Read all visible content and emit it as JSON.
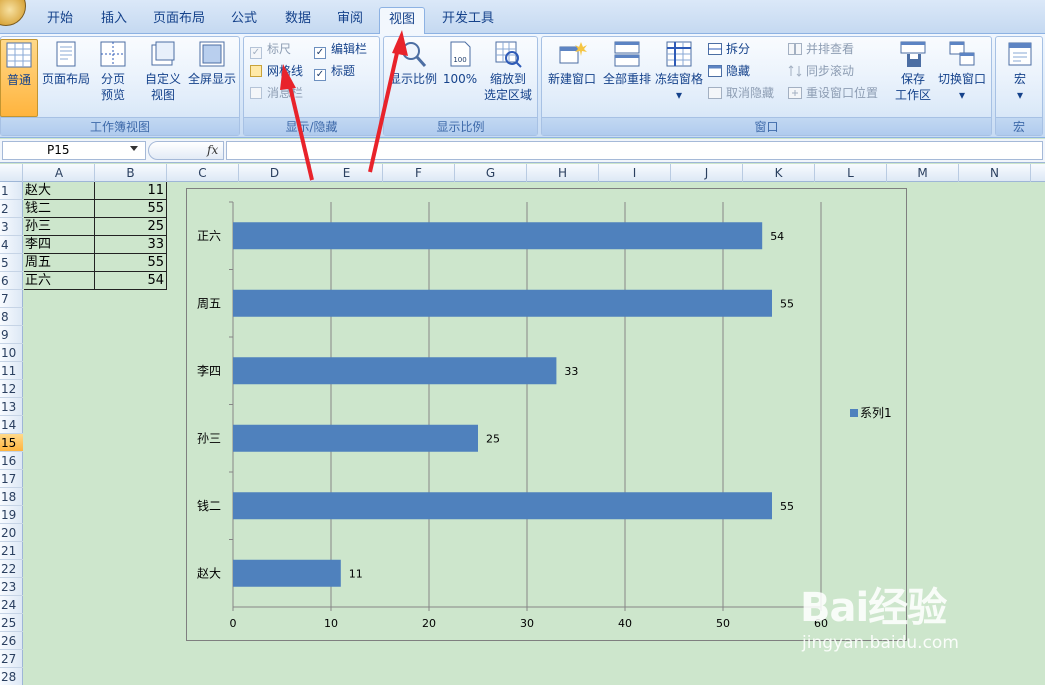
{
  "tabs": [
    {
      "label": "开始",
      "active": false
    },
    {
      "label": "插入",
      "active": false
    },
    {
      "label": "页面布局",
      "active": false
    },
    {
      "label": "公式",
      "active": false
    },
    {
      "label": "数据",
      "active": false
    },
    {
      "label": "审阅",
      "active": false
    },
    {
      "label": "视图",
      "active": true
    },
    {
      "label": "开发工具",
      "active": false
    }
  ],
  "ribbon": {
    "workbook_views": {
      "label": "工作簿视图",
      "normal": "普通",
      "page_layout": "页面布局",
      "page_break_line1": "分页",
      "page_break_line2": "预览",
      "custom_line1": "自定义",
      "custom_line2": "视图",
      "full_screen": "全屏显示"
    },
    "show_hide": {
      "label": "显示/隐藏",
      "ruler": "标尺",
      "gridlines": "网格线",
      "message_bar": "消息栏",
      "formula_bar": "编辑栏",
      "headings": "标题",
      "ruler_checked": true,
      "gridlines_checked": false,
      "message_bar_checked": false,
      "formula_bar_checked": true,
      "headings_checked": true
    },
    "zoom": {
      "label": "显示比例",
      "zoom": "显示比例",
      "hundred": "100%",
      "hundred_icon_text": "100",
      "zoom_sel_line1": "缩放到",
      "zoom_sel_line2": "选定区域"
    },
    "window": {
      "label": "窗口",
      "new_window": "新建窗口",
      "arrange_all": "全部重排",
      "freeze_panes": "冻结窗格",
      "split": "拆分",
      "hide": "隐藏",
      "unhide": "取消隐藏",
      "side_by_side": "并排查看",
      "sync_scroll": "同步滚动",
      "reset_position": "重设窗口位置",
      "save_workspace_line1": "保存",
      "save_workspace_line2": "工作区",
      "switch_windows": "切换窗口"
    },
    "macros": {
      "label": "宏",
      "macros": "宏"
    }
  },
  "formula_bar": {
    "name_box": "P15",
    "fx": "fx",
    "formula": ""
  },
  "columns": [
    "A",
    "B",
    "C",
    "D",
    "E",
    "F",
    "G",
    "H",
    "I",
    "J",
    "K",
    "L",
    "M",
    "N"
  ],
  "rows": [
    "1",
    "2",
    "3",
    "4",
    "5",
    "6",
    "7",
    "8",
    "9",
    "10",
    "11",
    "12",
    "13",
    "14",
    "15",
    "16",
    "17",
    "18",
    "19",
    "20",
    "21",
    "22",
    "23",
    "24",
    "25",
    "26",
    "27",
    "28"
  ],
  "selected_row": "15",
  "table": [
    {
      "name": "赵大",
      "value": "11"
    },
    {
      "name": "钱二",
      "value": "55"
    },
    {
      "name": "孙三",
      "value": "25"
    },
    {
      "name": "李四",
      "value": "33"
    },
    {
      "name": "周五",
      "value": "55"
    },
    {
      "name": "正六",
      "value": "54"
    }
  ],
  "chart_data": {
    "type": "bar",
    "orientation": "horizontal",
    "categories": [
      "赵大",
      "钱二",
      "孙三",
      "李四",
      "周五",
      "正六"
    ],
    "series": [
      {
        "name": "系列1",
        "values": [
          11,
          55,
          25,
          33,
          55,
          54
        ]
      }
    ],
    "data_labels": [
      "11",
      "55",
      "25",
      "33",
      "55",
      "54"
    ],
    "xlim": [
      0,
      60
    ],
    "x_ticks": [
      "0",
      "10",
      "20",
      "30",
      "40",
      "50",
      "60"
    ],
    "grid": true,
    "legend": "right",
    "bar_color": "#4f81bd"
  },
  "watermark": {
    "logo": "Bai经验",
    "sub": "jingyan.baidu.com"
  },
  "colors": {
    "sheet_bg": "#cde6cc",
    "accent": "#e8232b"
  }
}
